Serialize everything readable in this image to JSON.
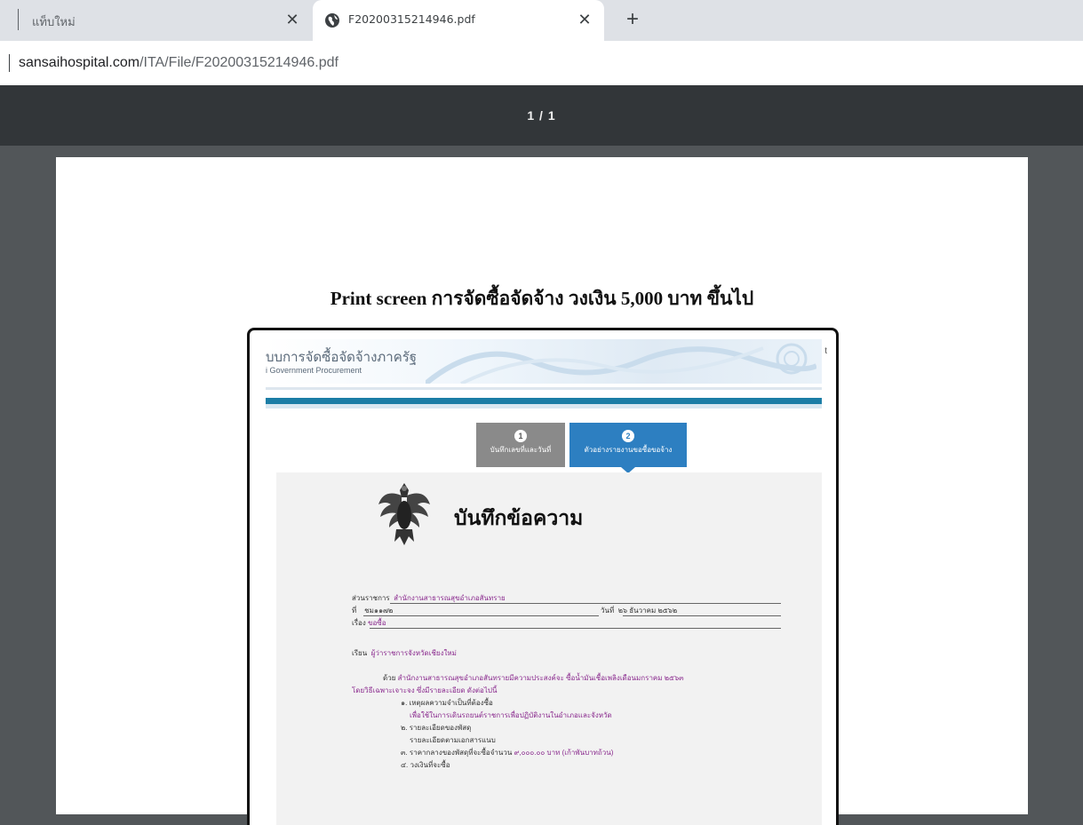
{
  "browser": {
    "tabs": [
      {
        "title": "แท็บใหม่",
        "active": false
      },
      {
        "title": "F20200315214946.pdf",
        "active": true
      }
    ],
    "new_tab_symbol": "+",
    "close_symbol": "✕",
    "url_host": "sansaihospital.com",
    "url_path": "/ITA/File/F20200315214946.pdf"
  },
  "pdf_viewer": {
    "page_indicator": "1 / 1",
    "background_color": "#525659",
    "toolbar_color": "#323639"
  },
  "document": {
    "heading": "Print screen การจัดซื้อจัดจ้าง วงเงิน 5,000 บาท ขึ้นไป",
    "embedded": {
      "site_title": "บบการจัดซื้อจัดจ้างภาครัฐ",
      "site_subtitle": "i Government Procurement",
      "corner_text": "t",
      "steps": [
        {
          "number": "1",
          "label": "บันทึกเลขที่และวันที่"
        },
        {
          "number": "2",
          "label": "ตัวอย่างรายงานขอซื้อขอจ้าง"
        }
      ],
      "memo": {
        "title": "บันทึกข้อความ",
        "department_label": "ส่วนราชการ",
        "department_value": "สำนักงานสาธารณสุขอำเภอสันทราย",
        "number_label": "ที่",
        "number_value": "ชม๑๑๗๒",
        "date_label": "วันที่",
        "date_value": "๒๖ ธันวาคม ๒๕๖๒",
        "subject_label": "เรื่อง",
        "subject_value": "ขอซื้อ",
        "to_label": "เรียน",
        "to_value": "ผู้ว่าราชการจังหวัดเชียงใหม่",
        "body_prefix": "ด้วย",
        "body_line1": "สำนักงานสาธารณสุขอำเภอสันทรายมีความประสงค์จะ ซื้อน้ำมันเชื้อเพลิงเดือนมกราคม ๒๕๖๓",
        "body_line2": "โดยวิธีเฉพาะเจาะจง ซึ่งมีรายละเอียด ดังต่อไปนี้",
        "item1": "๑. เหตุผลความจำเป็นที่ต้องซื้อ",
        "item1_detail": "เพื่อใช้ในการเดินรถยนต์ราชการเพื่อปฏิบัติงานในอำเภอและจังหวัด",
        "item2": "๒. รายละเอียดของพัสดุ",
        "item2_detail": "รายละเอียดตามเอกสารแนบ",
        "item3_prefix": "๓. ราคากลางของพัสดุที่จะซื้อจำนวน",
        "item3_amount": "๙,๐๐๐.๐๐ บาท",
        "item3_words": "(เก้าพันบาทถ้วน)",
        "item4": "๔. วงเงินที่จะซื้อ"
      }
    }
  }
}
